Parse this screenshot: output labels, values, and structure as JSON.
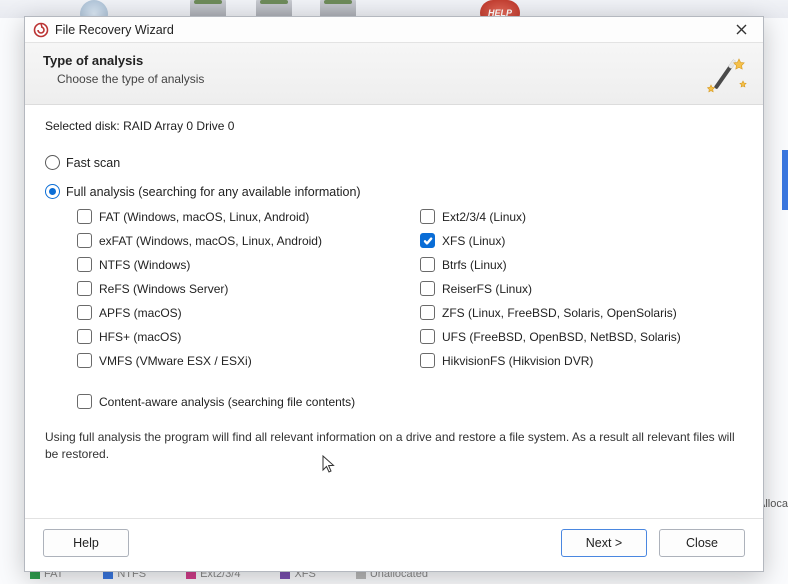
{
  "bg": {
    "help_label": "HELP",
    "swatches": [
      "FAT",
      "NTFS",
      "Ext2/3/4",
      "XFS",
      "Unallocated"
    ],
    "right_label": "Alloca"
  },
  "titlebar": {
    "title": "File Recovery Wizard"
  },
  "header": {
    "title": "Type of analysis",
    "subtitle": "Choose the type of analysis"
  },
  "selected_disk": {
    "label": "Selected disk:",
    "value": "RAID Array 0 Drive 0"
  },
  "scan_modes": {
    "fast": {
      "label": "Fast scan",
      "selected": false
    },
    "full": {
      "label": "Full analysis (searching for any available information)",
      "selected": true
    }
  },
  "filesystems": {
    "left": [
      {
        "key": "fat",
        "label": "FAT (Windows, macOS, Linux, Android)",
        "checked": false
      },
      {
        "key": "exfat",
        "label": "exFAT (Windows, macOS, Linux, Android)",
        "checked": false
      },
      {
        "key": "ntfs",
        "label": "NTFS (Windows)",
        "checked": false
      },
      {
        "key": "refs",
        "label": "ReFS (Windows Server)",
        "checked": false
      },
      {
        "key": "apfs",
        "label": "APFS (macOS)",
        "checked": false
      },
      {
        "key": "hfs",
        "label": "HFS+ (macOS)",
        "checked": false
      },
      {
        "key": "vmfs",
        "label": "VMFS (VMware ESX / ESXi)",
        "checked": false
      }
    ],
    "right": [
      {
        "key": "ext",
        "label": "Ext2/3/4 (Linux)",
        "checked": false
      },
      {
        "key": "xfs",
        "label": "XFS (Linux)",
        "checked": true
      },
      {
        "key": "btrfs",
        "label": "Btrfs (Linux)",
        "checked": false
      },
      {
        "key": "reiserfs",
        "label": "ReiserFS (Linux)",
        "checked": false
      },
      {
        "key": "zfs",
        "label": "ZFS (Linux, FreeBSD, Solaris, OpenSolaris)",
        "checked": false
      },
      {
        "key": "ufs",
        "label": "UFS (FreeBSD, OpenBSD, NetBSD, Solaris)",
        "checked": false
      },
      {
        "key": "hik",
        "label": "HikvisionFS (Hikvision DVR)",
        "checked": false
      }
    ]
  },
  "content_aware": {
    "label": "Content-aware analysis (searching file contents)",
    "checked": false
  },
  "description": "Using full analysis the program will find all relevant information on a drive and restore a file system. As a result all relevant files will be restored.",
  "buttons": {
    "help": "Help",
    "next": "Next >",
    "close": "Close"
  },
  "colors": {
    "accent": "#0a6dd6"
  }
}
